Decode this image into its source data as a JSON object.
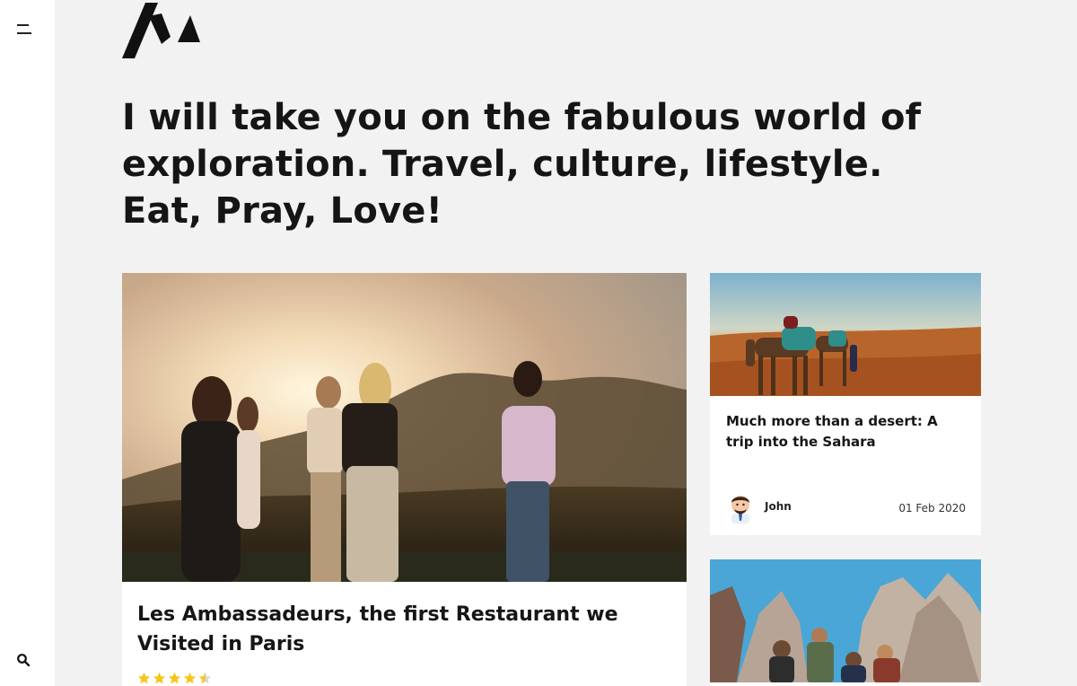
{
  "sidebar": {
    "menu_icon": "hamburger-menu-icon",
    "search_icon": "search-icon"
  },
  "logo": {
    "name": "logo-mark"
  },
  "hero": {
    "headline": "I will take you on the fabulous world of exploration. Travel, culture, lifestyle. Eat, Pray, Love!"
  },
  "featured_post": {
    "title": "Les Ambassadeurs, the first Restaurant we Visited in Paris",
    "rating": 4.5,
    "rating_max": 5,
    "star_color": "#f5c518"
  },
  "side_posts": [
    {
      "title": "Much more than a desert: A trip into the Sahara",
      "author": "John",
      "date": "01 Feb 2020"
    },
    {
      "title": ""
    }
  ]
}
